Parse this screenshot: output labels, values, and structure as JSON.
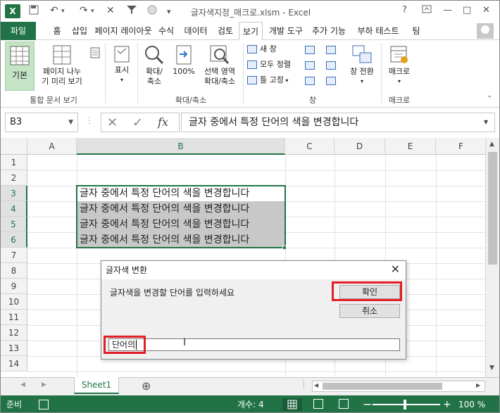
{
  "titlebar": {
    "title": "글자색지정_매크로.xlsm - Excel",
    "app_logo": "X",
    "controls": [
      "?",
      "□",
      "—",
      "□",
      "✕"
    ]
  },
  "tabs": [
    "파일",
    "홈",
    "삽입",
    "페이지 레이아웃",
    "수식",
    "데이터",
    "검토",
    "보기",
    "개발 도구",
    "추가 기능",
    "부하 테스트",
    "팀"
  ],
  "ribbon": {
    "view_normal": "기본",
    "view_pagebreak_1": "페이지 나누",
    "view_pagebreak_2": "기 미리 보기",
    "group_views": "통합 문서 보기",
    "show": "표시",
    "zoom_1": "확대/",
    "zoom_2": "축소",
    "zoom100": "100%",
    "zoom_sel_1": "선택 영역",
    "zoom_sel_2": "확대/축소",
    "group_zoom": "확대/축소",
    "new_window": "새 창",
    "arrange_all": "모두 정렬",
    "freeze": "틀 고정",
    "group_window": "창",
    "switch_window": "창 전환",
    "macro": "매크로",
    "group_macro": "매크로"
  },
  "formula_bar": {
    "name_box": "B3",
    "fx": "fx",
    "formula": "글자 중에서 특정 단어의 색을 변경합니다"
  },
  "grid": {
    "columns": [
      "A",
      "B",
      "C",
      "D",
      "E",
      "F"
    ],
    "rows": [
      "1",
      "2",
      "3",
      "4",
      "5",
      "6",
      "7",
      "8",
      "9",
      "10",
      "11",
      "12",
      "13",
      "14"
    ],
    "cells": {
      "b3": "글자 중에서 특정 단어의 색을 변경합니다",
      "b4": "글자 중에서 특정 단어의 색을 변경합니다",
      "b5": "글자 중에서 특정 단어의 색을 변경합니다",
      "b6": "글자 중에서 특정 단어의 색을 변경합니다"
    }
  },
  "dialog": {
    "title": "글자색 변환",
    "prompt": "글자색을 변경할 단어를 입력하세요",
    "ok": "확인",
    "cancel": "취소",
    "input_value": "단어의",
    "close": "✕"
  },
  "sheet": {
    "tab": "Sheet1",
    "add": "⊕"
  },
  "status": {
    "ready": "준비",
    "count": "개수: 4",
    "zoom": "100 %"
  },
  "colors": {
    "excel_green": "#217346",
    "highlight_red": "#e31e24",
    "selection_gray": "#c8c8c8"
  }
}
